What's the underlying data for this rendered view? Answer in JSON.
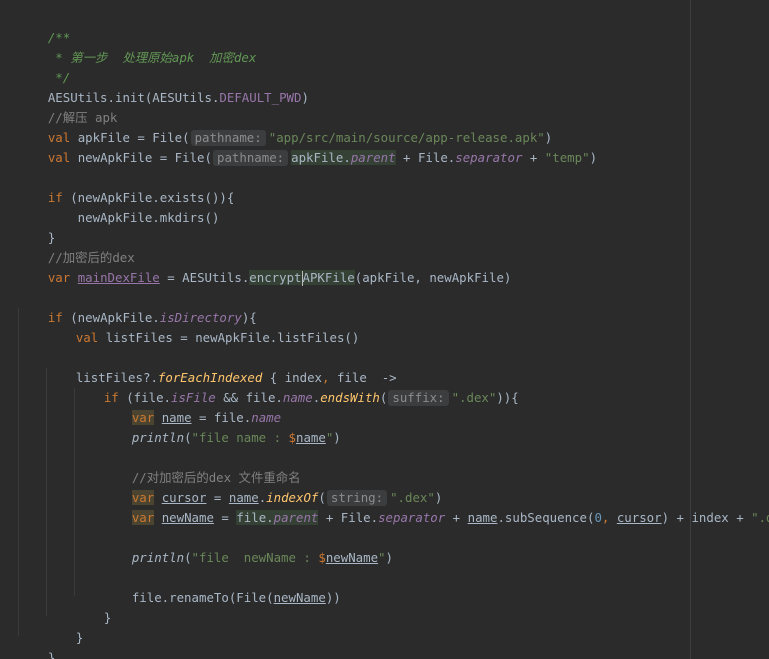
{
  "editor": {
    "doc_open": "/**",
    "doc_step": " * 第一步  处理原始apk  加密dex",
    "doc_close": " */",
    "ln_init": {
      "a": "AESUtils.init(AESUtils.",
      "b": "DEFAULT_PWD",
      "c": ")"
    },
    "cmt_unzip": "//解压 apk",
    "ln_apk": {
      "kw": "val",
      "a": " apkFile = File(",
      "hint": "pathname:",
      "str": "\"app/src/main/source/app-release.apk\"",
      "b": ")"
    },
    "ln_newapk": {
      "kw": "val",
      "a": " newApkFile = File(",
      "hint": "pathname:",
      "hl": "apkFile.",
      "prop": "parent",
      "b": " + File.",
      "sep": "separator",
      "c": " + ",
      "str": "\"temp\"",
      "d": ")"
    },
    "ln_if_exists": {
      "kw": "if",
      "a": " (newApkFile.exists()){"
    },
    "ln_mkdirs": "    newApkFile.mkdirs()",
    "ln_close1": "}",
    "cmt_encrypted": "//加密后的dex",
    "ln_maindex": {
      "kw": "var",
      "var": "mainDexFile",
      "a": " = AESUtils.",
      "fn_a": "encrypt",
      "fn_b": "APKFile",
      "b": "(apkFile, newApkFile)"
    },
    "ln_if_dir": {
      "kw": "if",
      "a": " (newApkFile.",
      "prop": "isDirectory",
      "b": "){"
    },
    "ln_listfiles": {
      "kw": "val",
      "a": " listFiles = newApkFile.listFiles()"
    },
    "ln_foreach": {
      "a": "listFiles?.",
      "fn": "forEachIndexed",
      "b": " { index",
      "comma": ",",
      "c": " file  ->"
    },
    "ln_if_isfile": {
      "kw": "if",
      "a": " (file.",
      "prop1": "isFile",
      "b": " && file.",
      "prop2": "name",
      "c": ".",
      "fn": "endsWith",
      "d": "(",
      "hint": "suffix:",
      "str": "\".dex\"",
      "e": ")){"
    },
    "ln_name": {
      "kw": "var",
      "var": "name",
      "a": " = file.",
      "prop": "name"
    },
    "ln_println1": {
      "fn": "println",
      "a": "(",
      "str1": "\"file name : ",
      "tpl": "$",
      "var": "name",
      "str2": "\"",
      "b": ")"
    },
    "cmt_rename": "//对加密后的dex 文件重命名",
    "ln_cursor": {
      "kw": "var",
      "var": "cursor",
      "a": " = ",
      "ref": "name",
      "b": ".",
      "fn": "indexOf",
      "c": "(",
      "hint": "string:",
      "str": "\".dex\"",
      "d": ")"
    },
    "ln_newname": {
      "kw": "var",
      "var": "newName",
      "a": " = ",
      "hl": "file.",
      "prop": "parent",
      "b": " + File.",
      "sep": "separator",
      "c": " + ",
      "ref1": "name",
      "d": ".subSequence(",
      "num": "0",
      "comma": ",",
      "e": " ",
      "ref2": "cursor",
      "f": ") + index + ",
      "str": "\".dex\""
    },
    "ln_println2": {
      "fn": "println",
      "a": "(",
      "str1": "\"file  newName : ",
      "tpl": "$",
      "var": "newName",
      "str2": "\"",
      "b": ")"
    },
    "ln_rename": {
      "a": "file.renameTo(File(",
      "ref": "newName",
      "b": "))"
    },
    "ln_close_if": "}",
    "ln_close_foreach": "}",
    "ln_close_outer": "}"
  },
  "colors": {
    "background": "#2b2b2b",
    "text": "#a9b7c6",
    "keyword": "#cc7832",
    "string": "#6a8759",
    "number": "#6897bb",
    "doc_comment": "#629755",
    "line_comment": "#808080",
    "property": "#9876aa",
    "function_call": "#ffc66d"
  }
}
